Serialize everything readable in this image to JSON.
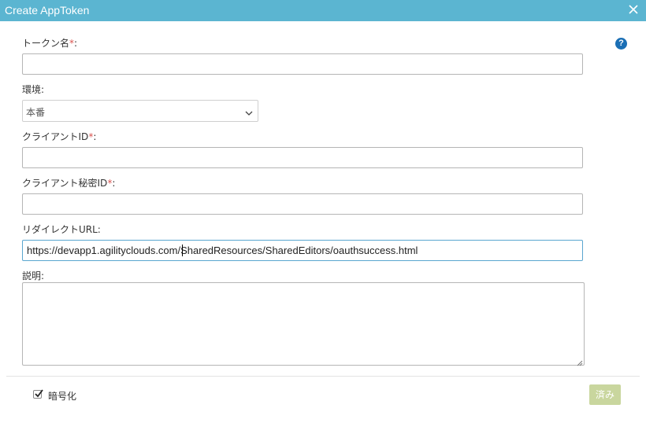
{
  "dialog": {
    "title": "Create AppToken"
  },
  "help": {
    "glyph": "?"
  },
  "fields": {
    "token_name": {
      "label": "トークン名",
      "required_mark": "*",
      "colon": ":",
      "value": ""
    },
    "environment": {
      "label": "環境:",
      "selected": "本番"
    },
    "client_id": {
      "label": "クライアントID",
      "required_mark": "*",
      "colon": ":",
      "value": ""
    },
    "client_secret": {
      "label": "クライアント秘密ID",
      "required_mark": "*",
      "colon": ":",
      "value": ""
    },
    "redirect_url": {
      "label": "リダイレクトURL:",
      "value": "https://devapp1.agilityclouds.com/SharedResources/SharedEditors/oauthsuccess.html"
    },
    "description": {
      "label": "説明:",
      "value": ""
    }
  },
  "footer": {
    "encrypt": {
      "label": "暗号化",
      "checked": true
    },
    "done_label": "済み"
  },
  "colors": {
    "header": "#5bb5d1",
    "help": "#1b6fb5",
    "done_button": "#c9d69e",
    "required": "#d9534f"
  },
  "icons": {
    "close": "close-icon",
    "help": "help-icon",
    "dropdown": "chevron-down-icon",
    "check": "checkmark-icon",
    "resize": "resize-grip-icon"
  }
}
